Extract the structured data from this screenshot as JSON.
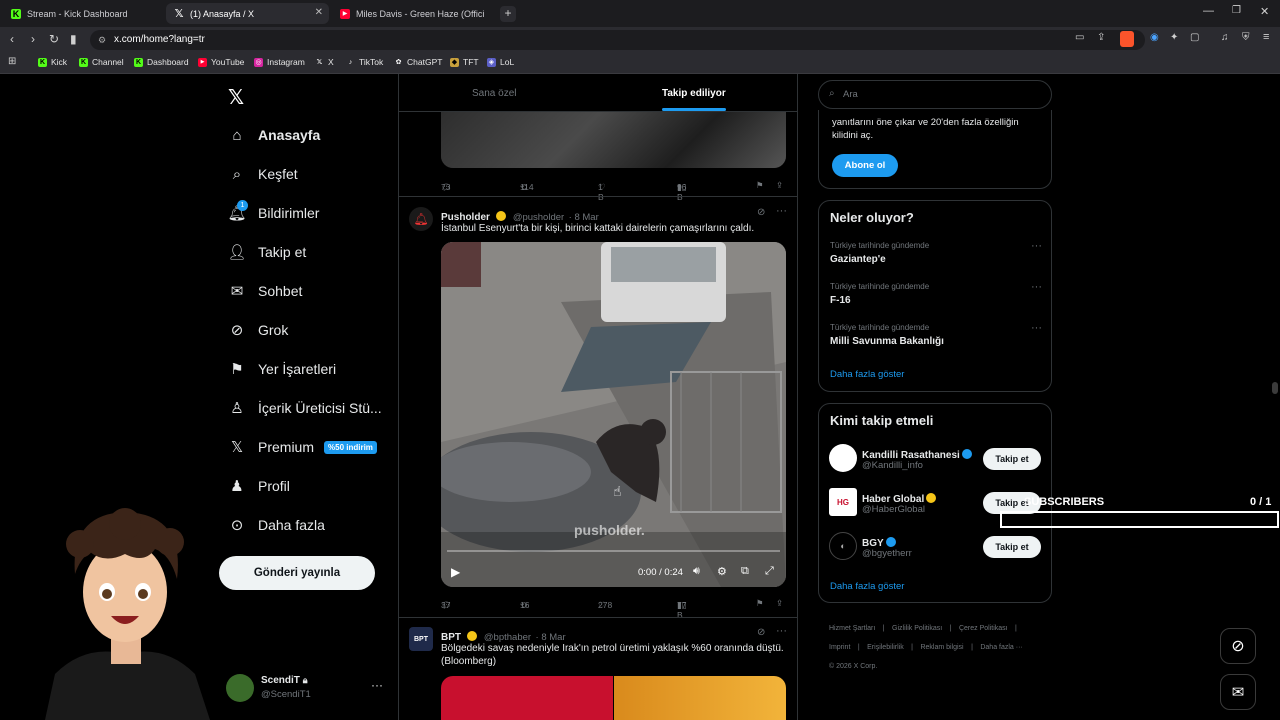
{
  "browser": {
    "tabs": [
      {
        "label": "Stream - Kick Dashboard",
        "icon": "kick-icon",
        "color": "#53fc18"
      },
      {
        "label": "(1) Anasayfa / X",
        "icon": "x-logo-icon",
        "color": "#ffffff"
      },
      {
        "label": "Miles Davis - Green Haze (Officia",
        "icon": "youtube-icon",
        "color": "#ff0033"
      }
    ],
    "url": "x.com/home?lang=tr",
    "bookmarks": [
      "Kick",
      "Channel",
      "Dashboard",
      "YouTube",
      "Instagram",
      "X",
      "TikTok",
      "ChatGPT",
      "TFT",
      "LoL"
    ]
  },
  "nav": {
    "items": [
      {
        "label": "Anasayfa",
        "icon": "home-icon"
      },
      {
        "label": "Keşfet",
        "icon": "search-icon"
      },
      {
        "label": "Bildirimler",
        "icon": "bell-icon",
        "badge": "1"
      },
      {
        "label": "Takip et",
        "icon": "add-user-icon"
      },
      {
        "label": "Sohbet",
        "icon": "mail-icon"
      },
      {
        "label": "Grok",
        "icon": "grok-icon"
      },
      {
        "label": "Yer İşaretleri",
        "icon": "bookmark-icon"
      },
      {
        "label": "İçerik Üreticisi Stü...",
        "icon": "creator-icon"
      },
      {
        "label": "Premium",
        "icon": "x-logo-icon",
        "badge": "%50 indirim"
      },
      {
        "label": "Profil",
        "icon": "profile-icon"
      },
      {
        "label": "Daha fazla",
        "icon": "more-circle-icon"
      }
    ],
    "post_button": "Gönderi yayınla",
    "account": {
      "name": "ScendiT",
      "handle": "@ScendiT1"
    }
  },
  "feed": {
    "tabs": [
      "Sana özel",
      "Takip ediliyor"
    ],
    "tweet0_stats": {
      "replies": "73",
      "retweets": "114",
      "likes": "1 B",
      "views": "96 B"
    },
    "tweet1": {
      "name": "Pusholder",
      "handle": "@pusholder",
      "date": "· 8 Mar",
      "text": "İstanbul Esenyurt'ta bir kişi, birinci kattaki dairelerin çamaşırlarını çaldı.",
      "video_time": "0:00 / 0:24",
      "watermark": "pusholder.",
      "stats": {
        "replies": "37",
        "retweets": "16",
        "likes": "278",
        "views": "77 B"
      }
    },
    "tweet2": {
      "name": "BPT",
      "handle": "@bpthaber",
      "date": "· 8 Mar",
      "text": "Bölgedeki savaş nedeniyle Irak'ın petrol üretimi yaklaşık %60 oranında düştü. (Bloomberg)",
      "avatar": "BPT"
    }
  },
  "sidebar": {
    "search_placeholder": "Ara",
    "premium_text_partial": "yanıtlarını öne çıkar ve 20'den fazla özelliğin kilidini aç.",
    "subscribe_label": "Abone ol",
    "trends_title": "Neler oluyor?",
    "trends": [
      {
        "category": "Türkiye tarihinde gündemde",
        "name": "Gaziantep'e"
      },
      {
        "category": "Türkiye tarihinde gündemde",
        "name": "F-16"
      },
      {
        "category": "Türkiye tarihinde gündemde",
        "name": "Milli Savunma Bakanlığı"
      }
    ],
    "show_more": "Daha fazla göster",
    "who_title": "Kimi takip etmeli",
    "who": [
      {
        "name": "Kandilli Rasathanesi",
        "handle": "@Kandilli_info",
        "verified": "blue",
        "button": "Takip et"
      },
      {
        "name": "Haber Global",
        "handle": "@HaberGlobal",
        "verified": "gold",
        "button": "Takip et"
      },
      {
        "name": "BGY",
        "handle": "@bgyetherr",
        "verified": "blue",
        "button": "Takip et"
      }
    ],
    "who_show_more": "Daha fazla göster",
    "footer": [
      "Hizmet Şartları",
      "Gizlilik Politikası",
      "Çerez Politikası",
      "Imprint",
      "Erişilebilirlik",
      "Reklam bilgisi",
      "Daha fazla ···",
      "© 2026 X Corp."
    ]
  },
  "overlay": {
    "subscribers_label": "SUBSCRIBERS",
    "subscribers_count": "0 / 1"
  },
  "colors": {
    "accent": "#1d9bf0",
    "gold": "#f5c518"
  }
}
